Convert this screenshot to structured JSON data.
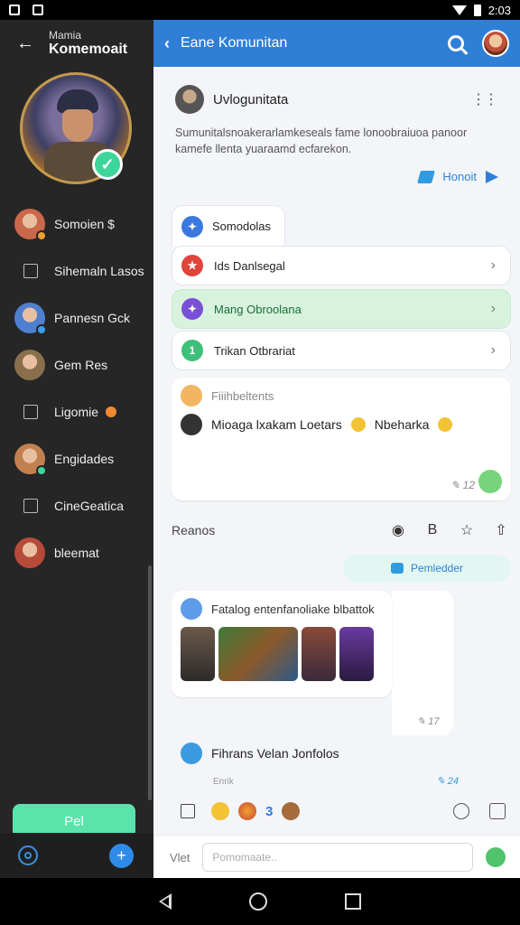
{
  "statusbar": {
    "time": "2:03"
  },
  "drawer": {
    "subtitle": "Mamia",
    "title": "Komemoait",
    "items": [
      {
        "label": "Somoien $",
        "type": "avatar",
        "color": "#c9684a",
        "dot": "#f0a030"
      },
      {
        "label": "Sihemaln Lasos",
        "type": "icon"
      },
      {
        "label": "Pannesn Gck",
        "type": "avatar",
        "color": "#4e7fd0",
        "dot": "#3aa0ee"
      },
      {
        "label": "Gem Res",
        "type": "avatar",
        "color": "#8a6f4d",
        "dot": ""
      },
      {
        "label": "Ligomie",
        "type": "icon",
        "badge": "orange"
      },
      {
        "label": "Engidades",
        "type": "avatar",
        "color": "#c08050",
        "dot": "#3ed59a"
      },
      {
        "label": "CineGeatica",
        "type": "icon"
      },
      {
        "label": "bleemat",
        "type": "avatar",
        "color": "#b84a3a",
        "dot": ""
      }
    ],
    "button_label": "Pel"
  },
  "appbar": {
    "title": "Eane Komunitan"
  },
  "intro": {
    "name": "Uvlogunitata",
    "description": "Sumunitalsnoakerarlamkeseals fame lonoobraiuoa panoor kamefe llenta yuaraamd ecfarekon.",
    "link_label": "Honoit"
  },
  "menu": {
    "tab_label": "Somodolas",
    "rows": [
      {
        "label": "Ids Danlsegal",
        "icon_color": "#e0443a",
        "active": false
      },
      {
        "label": "Mang Obroolana",
        "icon_color": "#7a4fd8",
        "active": true
      },
      {
        "label": "Trikan Otbrariat",
        "icon_color": "#3ec07a",
        "active": false
      }
    ]
  },
  "post1": {
    "header": "Fiiihbeltents",
    "body": "Mioaga lxakam Loetars",
    "body_tail": "Nbeharka",
    "meta": "12"
  },
  "section": {
    "label": "Reanos"
  },
  "pill": {
    "label": "Pemledder"
  },
  "post2": {
    "header": "Fatalog entenfanoliake blbattok",
    "meta": "17"
  },
  "post3": {
    "title": "Fihrans Velan Jonfolos",
    "sub": "Enrik",
    "meta": "24"
  },
  "reactions": {
    "count": "3"
  },
  "composer": {
    "label": "Vlet",
    "placeholder": "Pomomaate.."
  }
}
